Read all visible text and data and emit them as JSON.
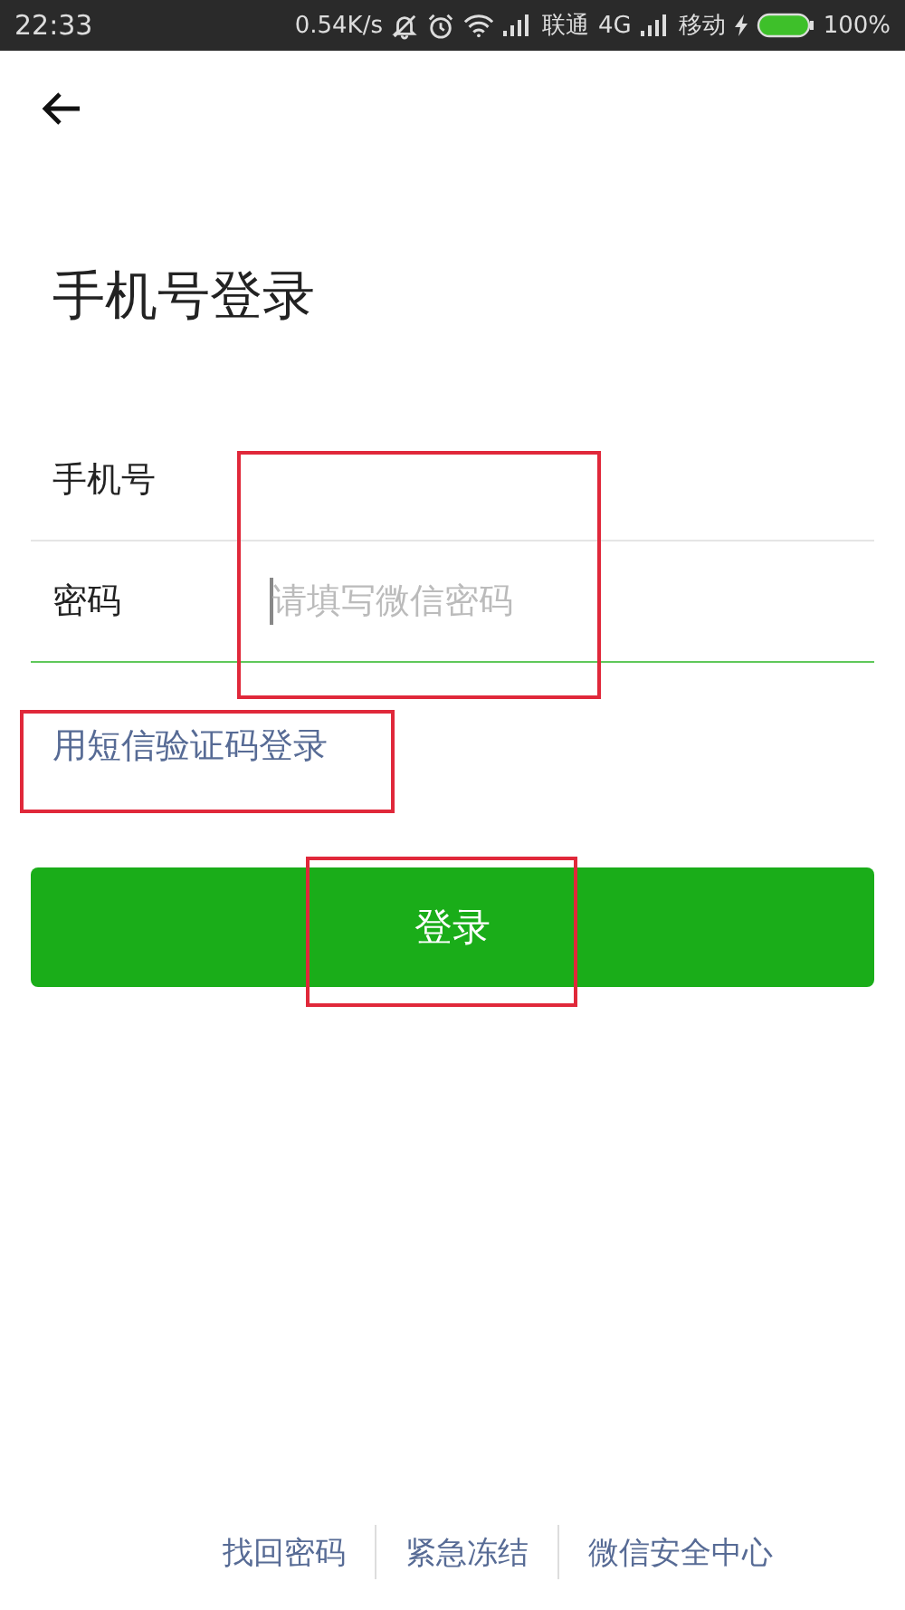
{
  "status_bar": {
    "time": "22:33",
    "speed": "0.54K/s",
    "carrier_1": "联通",
    "network_1": "4G",
    "carrier_2": "移动",
    "battery": "100%"
  },
  "title": "手机号登录",
  "fields": [
    {
      "label": "手机号",
      "focused": false
    },
    {
      "label": "密码",
      "placeholder": "请填写微信密码",
      "focused": true
    }
  ],
  "sms_link": "用短信验证码登录",
  "login_button": "登录",
  "footer_links": [
    "找回密码",
    "紧急冻结",
    "微信安全中心"
  ]
}
